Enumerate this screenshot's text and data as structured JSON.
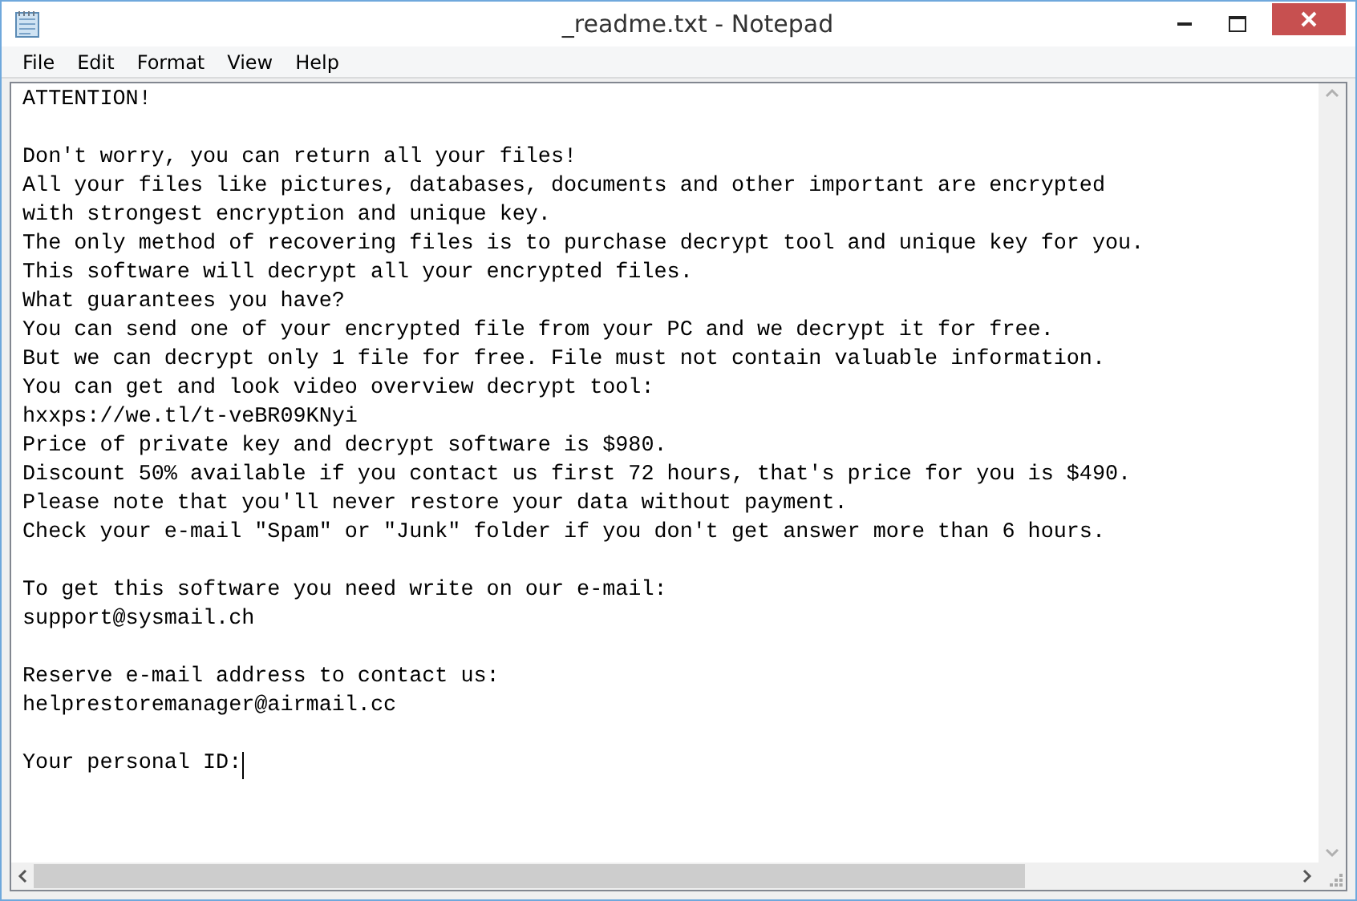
{
  "window": {
    "title": "_readme.txt - Notepad"
  },
  "menu": [
    "File",
    "Edit",
    "Format",
    "View",
    "Help"
  ],
  "editor": {
    "caret_visible": true,
    "paragraphs": [
      [
        "ATTENTION!"
      ],
      [
        "Don't worry, you can return all your files!",
        "All your files like pictures, databases, documents and other important are encrypted",
        "with strongest encryption and unique key.",
        "The only method of recovering files is to purchase decrypt tool and unique key for you.",
        "This software will decrypt all your encrypted files.",
        "What guarantees you have?",
        "You can send one of your encrypted file from your PC and we decrypt it for free.",
        "But we can decrypt only 1 file for free. File must not contain valuable information.",
        "You can get and look video overview decrypt tool:",
        "hxxps://we.tl/t-veBR09KNyi",
        "Price of private key and decrypt software is $980.",
        "Discount 50% available if you contact us first 72 hours, that's price for you is $490.",
        "Please note that you'll never restore your data without payment.",
        "Check your e-mail \"Spam\" or \"Junk\" folder if you don't get answer more than 6 hours."
      ],
      [
        "To get this software you need write on our e-mail:",
        "support@sysmail.ch"
      ],
      [
        "Reserve e-mail address to contact us:",
        "helprestoremanager@airmail.cc"
      ],
      [
        "Your personal ID:"
      ]
    ]
  }
}
